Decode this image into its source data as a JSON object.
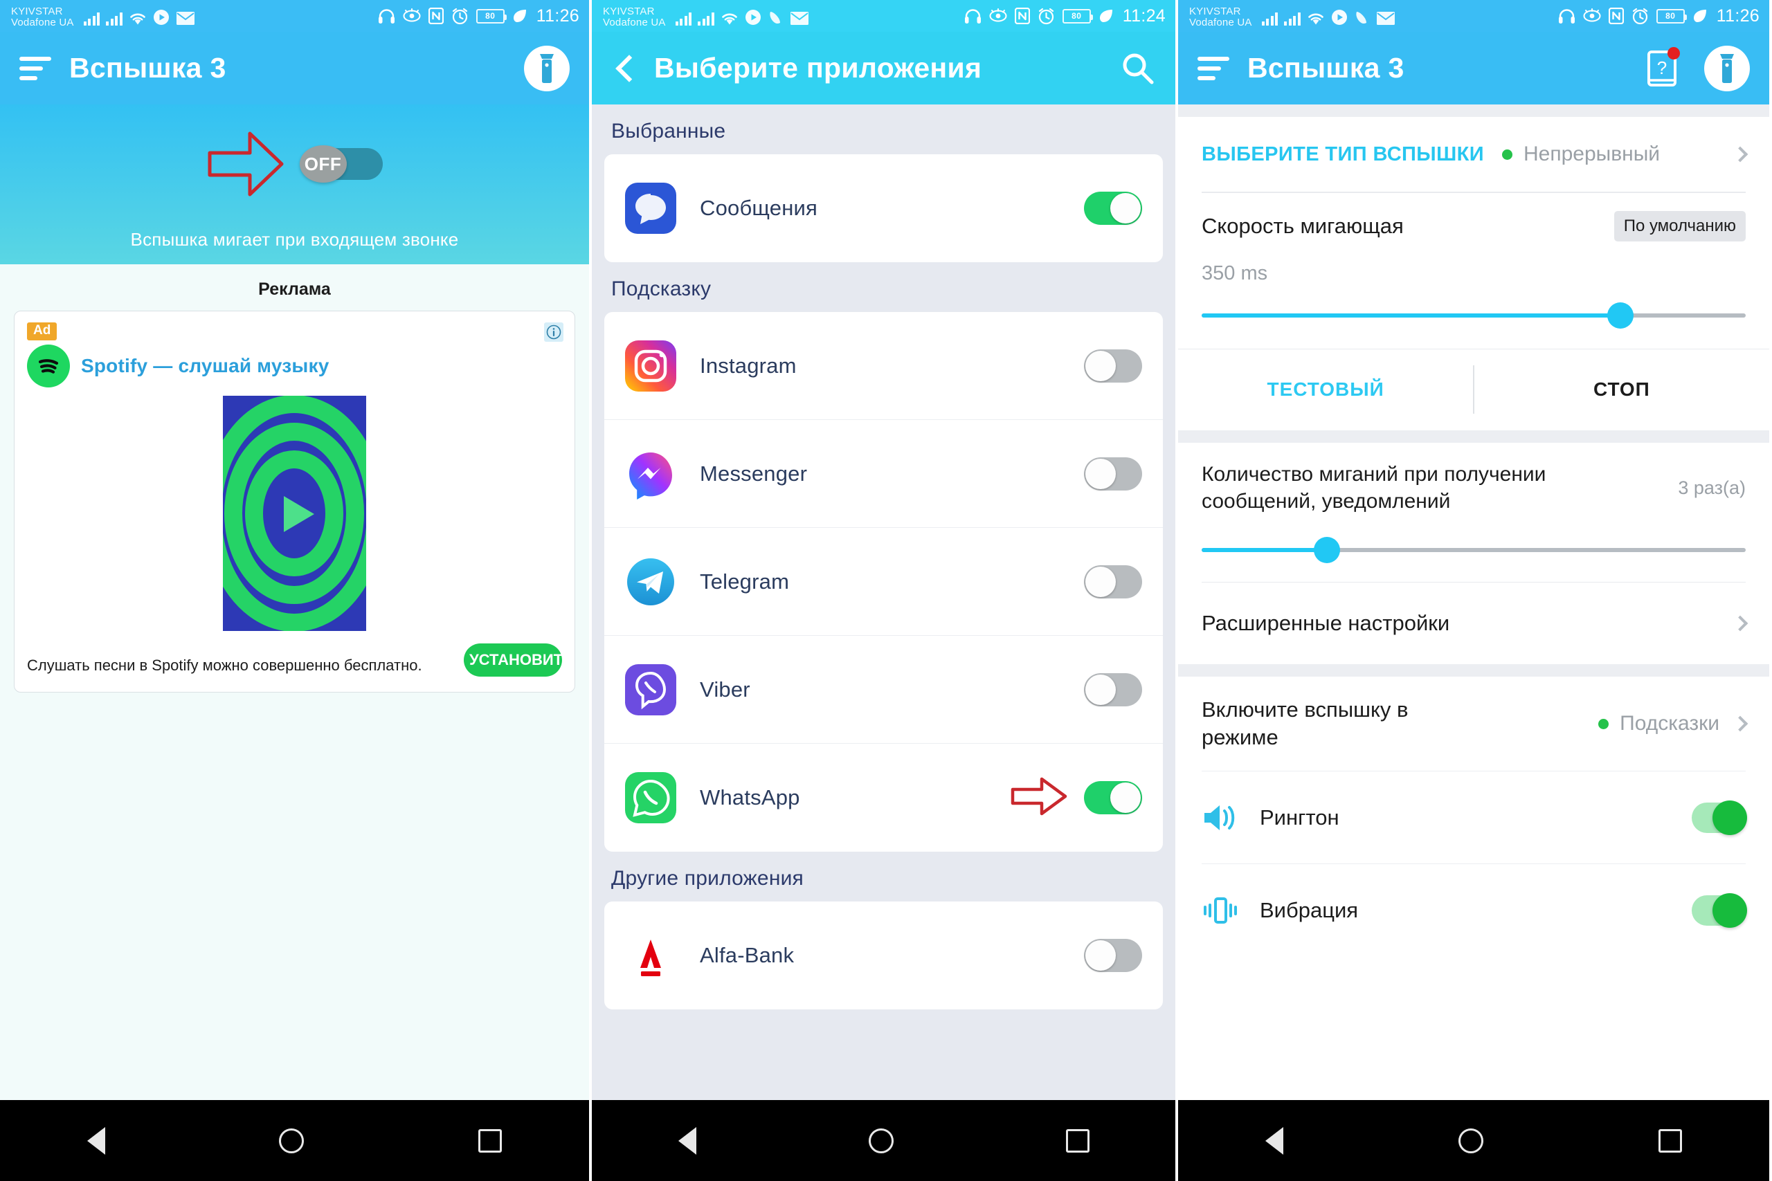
{
  "status_bar": {
    "carrier_line1": "KYIVSTAR",
    "carrier_line2": "Vodafone UA",
    "battery_level": "80",
    "clock_p1": "11:26",
    "clock_p2": "11:24",
    "clock_p3": "11:26",
    "icons": [
      "signal-bars-icon",
      "signal-bars-icon",
      "wifi-icon",
      "play-icon",
      "mail-icon",
      "headphones-icon",
      "eye-icon",
      "nfc-icon",
      "alarm-icon",
      "battery-icon",
      "leaf-icon"
    ]
  },
  "panel1": {
    "appbar": {
      "title": "Вспышка 3",
      "menu_icon": "hamburger-icon",
      "torch_icon": "flashlight-icon"
    },
    "toggle": {
      "state_label": "OFF",
      "is_on": false
    },
    "caption": "Вспышка мигает при входящем звонке",
    "ad": {
      "section_label": "Реклама",
      "badge": "Ad",
      "info_icon": "info-icon",
      "advertiser_icon": "spotify-icon",
      "title": "Spotify — слушай музыку",
      "description": "Слушать песни в Spotify можно совершенно бесплатно.",
      "cta_label": "УСТАНОВИТЬ"
    }
  },
  "panel2": {
    "appbar": {
      "title": "Выберите приложения",
      "back_icon": "back-chevron-icon",
      "search_icon": "search-icon"
    },
    "groups": [
      {
        "heading": "Выбранные",
        "apps": [
          {
            "name": "Сообщения",
            "icon": "messages-icon",
            "enabled": true,
            "arrow": false
          }
        ]
      },
      {
        "heading": "Подсказку",
        "apps": [
          {
            "name": "Instagram",
            "icon": "instagram-icon",
            "enabled": false,
            "arrow": false
          },
          {
            "name": "Messenger",
            "icon": "messenger-icon",
            "enabled": false,
            "arrow": false
          },
          {
            "name": "Telegram",
            "icon": "telegram-icon",
            "enabled": false,
            "arrow": false
          },
          {
            "name": "Viber",
            "icon": "viber-icon",
            "enabled": false,
            "arrow": false
          },
          {
            "name": "WhatsApp",
            "icon": "whatsapp-icon",
            "enabled": true,
            "arrow": true
          }
        ]
      },
      {
        "heading": "Другие приложения",
        "apps": [
          {
            "name": "Alfa-Bank",
            "icon": "alfabank-icon",
            "enabled": false,
            "arrow": false
          }
        ]
      }
    ]
  },
  "panel3": {
    "appbar": {
      "title": "Вспышка 3",
      "menu_icon": "hamburger-icon",
      "help_icon": "help-book-icon",
      "torch_icon": "flashlight-icon",
      "badge_color": "#e32020"
    },
    "flash_type": {
      "label": "ВЫБЕРИТЕ ТИП ВСПЫШКИ",
      "value": "Непрерывный",
      "dot_color": "#25c24a"
    },
    "blink_speed": {
      "label": "Скорость мигающая",
      "chip": "По умолчанию",
      "value": "350 ms",
      "percent": 77
    },
    "test_buttons": {
      "test": "ТЕСТОВЫЙ",
      "stop": "СТОП"
    },
    "blink_count": {
      "label": "Количество миганий при получении сообщений, уведомлений",
      "value": "3 раз(а)",
      "percent": 23
    },
    "advanced": {
      "label": "Расширенные настройки"
    },
    "mode": {
      "label": "Включите вспышку в режиме",
      "value": "Подсказки",
      "dot_color": "#25c24a"
    },
    "sound_rows": [
      {
        "label": "Рингтон",
        "icon": "speaker-icon",
        "enabled": true
      },
      {
        "label": "Вибрация",
        "icon": "vibration-icon",
        "enabled": true
      }
    ]
  },
  "nav_bar": {
    "back": "back-triangle-icon",
    "home": "home-circle-icon",
    "recents": "recents-square-icon"
  },
  "colors": {
    "accent_blue": "#33c1f3",
    "header_blue": "#39bdf4",
    "green_on": "#1fd06a",
    "gray_off": "#b8bcbf",
    "red_arrow": "#c9282d"
  }
}
